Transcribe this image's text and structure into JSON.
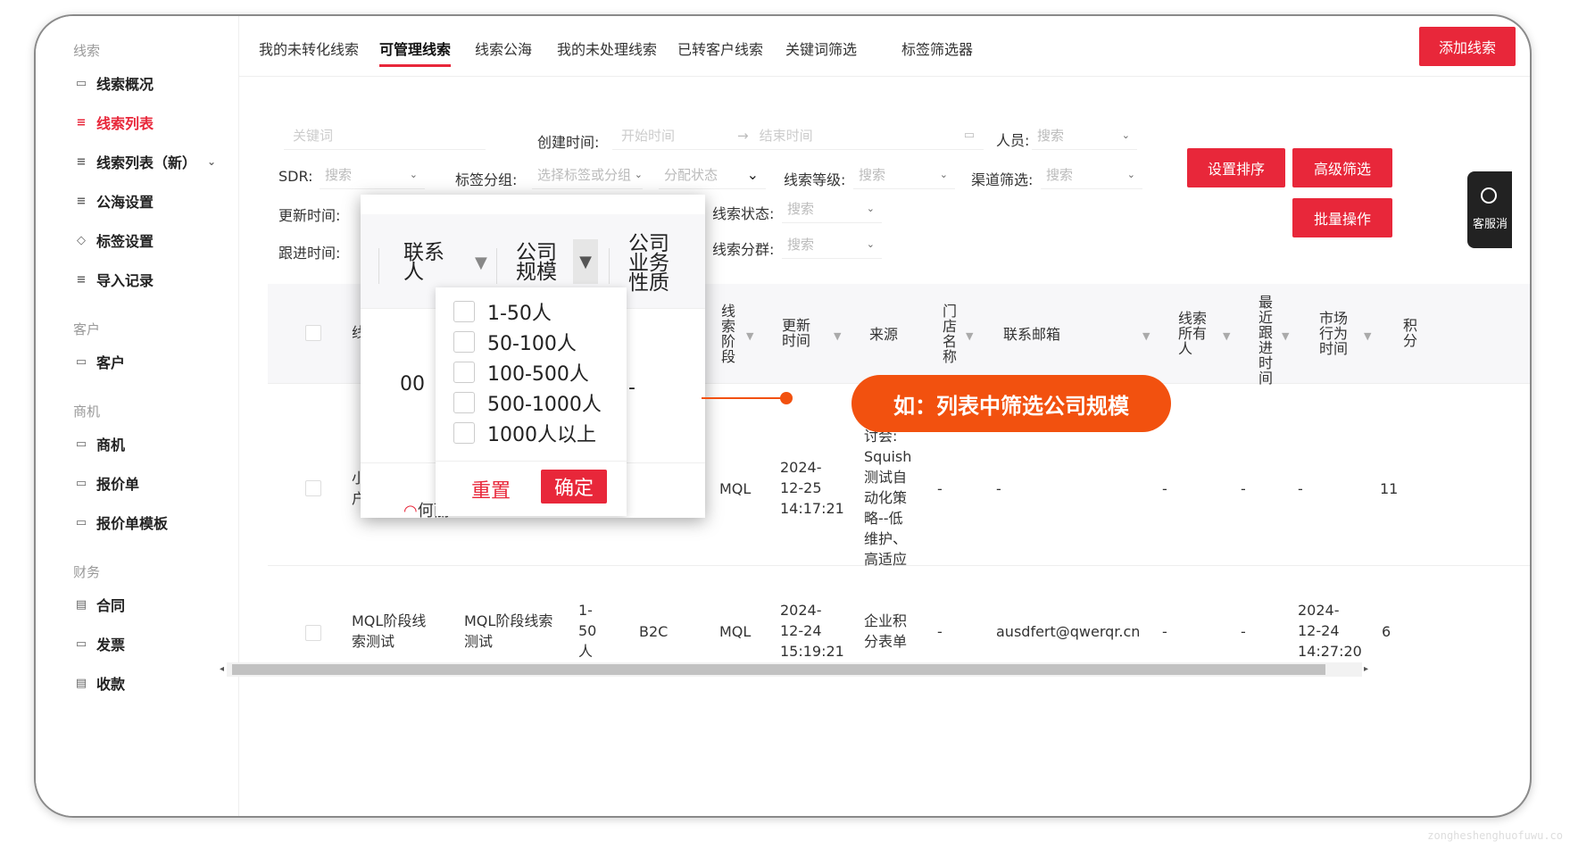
{
  "sidebar": {
    "groups": {
      "leads": "线索",
      "customers": "客户",
      "opportunities": "商机",
      "finance": "财务"
    },
    "items": [
      {
        "label": "线索概况"
      },
      {
        "label": "线索列表"
      },
      {
        "label": "线索列表（新）"
      },
      {
        "label": "公海设置"
      },
      {
        "label": "标签设置"
      },
      {
        "label": "导入记录"
      },
      {
        "label": "客户"
      },
      {
        "label": "商机"
      },
      {
        "label": "报价单"
      },
      {
        "label": "报价单模板"
      },
      {
        "label": "合同"
      },
      {
        "label": "发票"
      },
      {
        "label": "收款"
      }
    ]
  },
  "tabs": [
    {
      "label": "我的未转化线索"
    },
    {
      "label": "可管理线索"
    },
    {
      "label": "线索公海"
    },
    {
      "label": "我的未处理线索"
    },
    {
      "label": "已转客户线索"
    },
    {
      "label": "关键词筛选"
    },
    {
      "label": "标签筛选器"
    }
  ],
  "add_button": "添加线索",
  "filters": {
    "keyword_placeholder": "关键词",
    "created_label": "创建时间:",
    "start_placeholder": "开始时间",
    "end_placeholder": "结束时间",
    "person_label": "人员:",
    "search_placeholder": "搜索",
    "sdr_label": "SDR:",
    "tag_group_label": "标签分组:",
    "tag_group_placeholder": "选择标签或分组",
    "assign_placeholder": "分配状态",
    "level_label": "线索等级:",
    "channel_label": "渠道筛选:",
    "updated_label": "更新时间:",
    "status_label": "线索状态:",
    "follow_label": "跟进时间:",
    "segment_label": "线索分群:"
  },
  "buttons": {
    "sort": "设置排序",
    "advanced": "高级筛选",
    "batch": "批量操作"
  },
  "table": {
    "headers": {
      "lead": "线",
      "stage": "线索阶段",
      "updated": "更新时间",
      "source": "来源",
      "store": "门店名称",
      "email": "联系邮箱",
      "owner": "线索所有人",
      "last_follow": "最近跟进时间",
      "market": "市场行为时间",
      "score": "积分"
    },
    "row1": {
      "lead": "小\n户",
      "stage": "MQL",
      "updated": "2024-\n12-25\n14:17:21",
      "source": "网络研\n讨会:\nSquish\n测试自\n动化策\n略--低\n维护、\n高适应",
      "store": "-",
      "email": "-",
      "owner": "-",
      "last_follow": "-",
      "market": "-",
      "score": "11"
    },
    "row2": {
      "lead": "MQL阶段线\n索测试",
      "company": "MQL阶段线索\n测试",
      "size": "1-\n50\n人",
      "biz": "B2C",
      "stage": "MQL",
      "updated": "2024-\n12-24\n15:19:21",
      "source": "企业积\n分表单",
      "store": "-",
      "email": "ausdfert@qwerqr.cn",
      "owner": "-",
      "last_follow": "-",
      "market": "2024-\n12-24\n14:27:20",
      "score": "6"
    }
  },
  "zoom": {
    "contact_header": "联系\n人",
    "size_header": "公司\n规模",
    "biz_header": "公司\n业务\n性质",
    "cell_left": "00",
    "cell_right": "-",
    "partial_text": "何丽",
    "options": [
      "1-50人",
      "50-100人",
      "100-500人",
      "500-1000人",
      "1000人以上"
    ],
    "reset": "重置",
    "confirm": "确定"
  },
  "callout": "如：列表中筛选公司规模",
  "kefu_label": "客服消",
  "watermark": "zongheshenghuofuwu.co",
  "colors": {
    "accent": "#e8273a",
    "callout": "#f2510f"
  }
}
